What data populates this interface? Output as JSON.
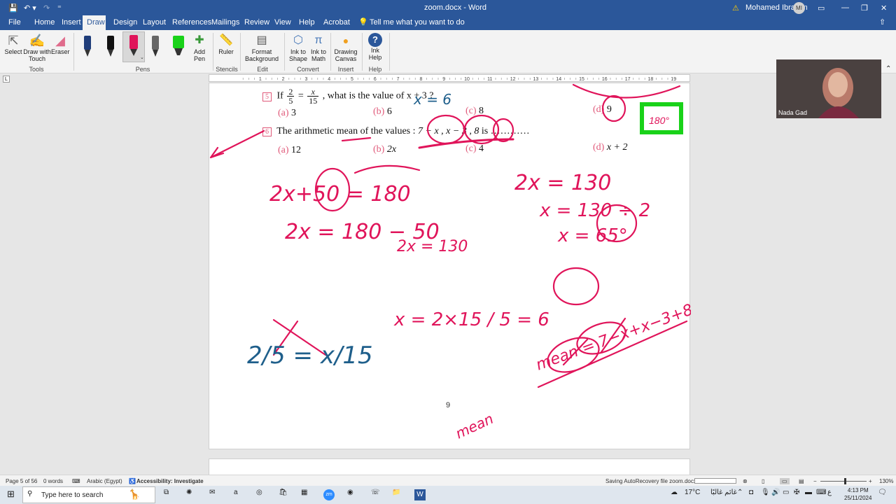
{
  "titlebar": {
    "doc_title": "zoom.docx - Word",
    "user_name": "Mohamed Ibrahim",
    "user_initials": "MI"
  },
  "tabs": [
    "File",
    "Home",
    "Insert",
    "Draw",
    "Design",
    "Layout",
    "References",
    "Mailings",
    "Review",
    "View",
    "Help",
    "Acrobat"
  ],
  "tell_me": "Tell me what you want to do",
  "ribbon": {
    "tools": {
      "select": "Select",
      "draw_touch": "Draw with Touch",
      "eraser": "Eraser",
      "group": "Tools"
    },
    "pens_group": "Pens",
    "add_pen": "Add Pen",
    "ruler": "Ruler",
    "stencils": "Stencils",
    "format_bg": "Format Background",
    "edit": "Edit",
    "ink_shape": "Ink to Shape",
    "ink_math": "Ink to Math",
    "convert": "Convert",
    "drawing_canvas": "Drawing Canvas",
    "insert": "Insert",
    "ink_help": "Ink Help",
    "help": "Help"
  },
  "ruler_numbers": [
    "1",
    "2",
    "3",
    "4",
    "5",
    "6",
    "7",
    "8",
    "9",
    "10",
    "11",
    "12",
    "13",
    "14",
    "15",
    "16",
    "17",
    "18",
    "19"
  ],
  "doc": {
    "q5": {
      "num": "5",
      "text_a": "If",
      "text_b": ", what is the value of",
      "text_c": "x + 3 ?",
      "opts": [
        {
          "l": "(a)",
          "v": "3"
        },
        {
          "l": "(b)",
          "v": "6"
        },
        {
          "l": "(c)",
          "v": "8"
        },
        {
          "l": "(d)",
          "v": "9"
        }
      ]
    },
    "q6": {
      "num": "6",
      "text": "The arithmetic mean of the values :",
      "vals": "7 − x , x − 3 , 8",
      "tail": "is …………",
      "opts": [
        {
          "l": "(a)",
          "v": "12"
        },
        {
          "l": "(b)",
          "v": "2x"
        },
        {
          "l": "(c)",
          "v": "4"
        },
        {
          "l": "(d)",
          "v": "x + 2"
        }
      ]
    },
    "page_number": "9",
    "ink_lines": [
      "2x+50 = 180",
      "2x = 180 − 50",
      "2x = 130",
      "2x = 130",
      "x = 130 ÷ 2",
      "x = 65°",
      "2/5 = x/15",
      "x = 2×15 / 5 = 6",
      "mean = 7−x+x−3+8 / 3",
      "x = 6",
      "180°"
    ]
  },
  "webcam": {
    "name": "Nada Gad"
  },
  "statusbar": {
    "page": "Page 5 of 56",
    "words": "0 words",
    "lang": "Arabic (Egypt)",
    "access": "Accessibility: Investigate",
    "saving": "Saving AutoRecovery file zoom.docx:",
    "zoom": "130%"
  },
  "taskbar": {
    "search": "Type here to search",
    "weather": "17°C",
    "weather_desc": "غائم غالبًا",
    "time": "4:13 PM",
    "date": "25/11/2024"
  },
  "colors": {
    "accent": "#2b579a",
    "ink_pink": "#e0145a",
    "ink_blue": "#1f5f8b",
    "highlight": "#19d219"
  }
}
